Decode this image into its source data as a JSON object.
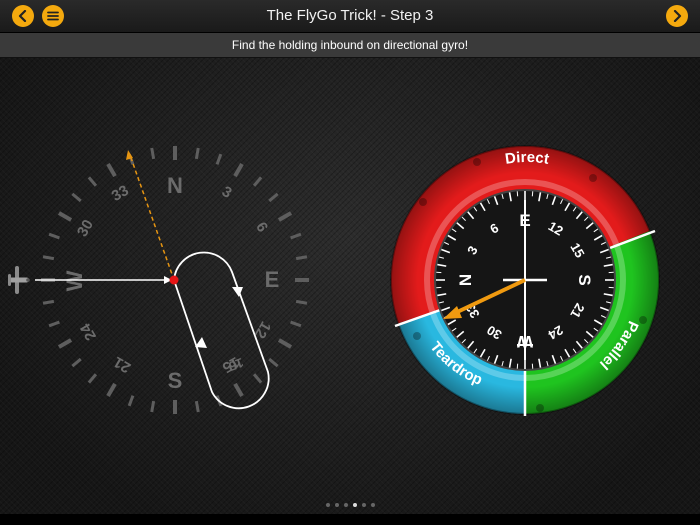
{
  "header": {
    "title": "The FlyGo Trick! - Step 3",
    "back_icon": "chevron-left-icon",
    "menu_icon": "hamburger-menu-icon",
    "next_icon": "chevron-right-icon",
    "accent_color": "#f4a90e"
  },
  "subheader": {
    "instruction": "Find the holding inbound on directional gyro!"
  },
  "compass": {
    "cardinals": [
      "N",
      "E",
      "S",
      "W"
    ],
    "numbers": [
      "3",
      "6",
      "12",
      "15",
      "21",
      "24",
      "30",
      "33"
    ],
    "holding_label": "15"
  },
  "gyro": {
    "sectors": {
      "direct": "Direct",
      "parallel": "Parallel",
      "teardrop": "Teardrop"
    },
    "sector_colors": {
      "direct": "#e31b1b",
      "parallel": "#1fc41f",
      "teardrop": "#29b8e0"
    },
    "cardinals": [
      "E",
      "S",
      "W",
      "N"
    ],
    "numbers": [
      "12",
      "15",
      "21",
      "24",
      "30",
      "33",
      "3",
      "6"
    ]
  },
  "pagination": {
    "total": 6,
    "current": 4
  }
}
